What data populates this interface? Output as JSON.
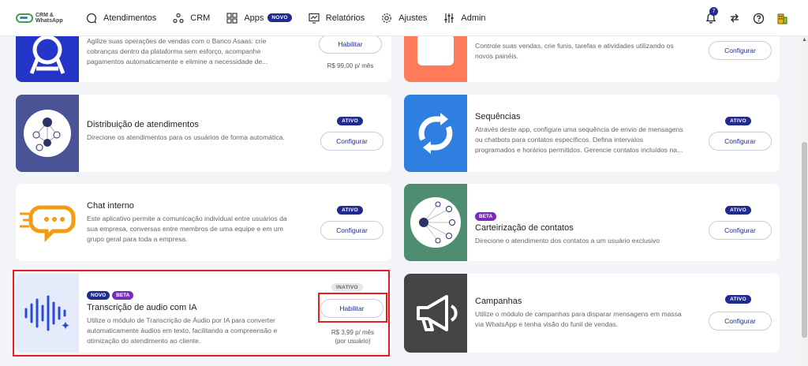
{
  "app": {
    "logo_text": "CRM & WhatsApp"
  },
  "nav": [
    {
      "label": "Atendimentos",
      "icon": "chat-icon"
    },
    {
      "label": "CRM",
      "icon": "crm-icon"
    },
    {
      "label": "Apps",
      "icon": "apps-grid-icon",
      "badge": "NOVO"
    },
    {
      "label": "Relatórios",
      "icon": "reports-icon"
    },
    {
      "label": "Ajustes",
      "icon": "gear-icon"
    },
    {
      "label": "Admin",
      "icon": "sliders-icon"
    }
  ],
  "topright": {
    "notifications": "7"
  },
  "cards": {
    "asaas": {
      "desc": "Agilize suas operações de vendas com o Banco Asaas: crie cobranças dentro da plataforma sem esforço, acompanhe pagamentos automaticamente e elimine a necessidade de...",
      "button": "Habilitar",
      "price": "R$ 99,00 p/ mês"
    },
    "funis": {
      "desc": "Controle suas vendas, crie funis, tarefas e atividades utilizando os novos painéis.",
      "button": "Configurar"
    },
    "distribuicao": {
      "title": "Distribuição de atendimentos",
      "desc": "Direcione os atendimentos para os usuários de forma automática.",
      "status": "ATIVO",
      "button": "Configurar"
    },
    "sequencias": {
      "title": "Sequências",
      "desc": "Através deste app, configure uma sequência de envio de mensagens ou chatbots para contatos específicos. Defina intervalos programados e horários permitidos. Gerencie contatos incluídos na...",
      "status": "ATIVO",
      "button": "Configurar"
    },
    "chat": {
      "title": "Chat interno",
      "desc": "Este aplicativo permite a comunicação individual entre usuários da sua empresa, conversas entre membros de uma equipe e em um grupo geral para toda a empresa.",
      "status": "ATIVO",
      "button": "Configurar"
    },
    "carteirizacao": {
      "tag": "BETA",
      "title": "Carteirização de contatos",
      "desc": "Direcione o atendimento dos contatos a um usuário exclusivo",
      "status": "ATIVO",
      "button": "Configurar"
    },
    "transcricao": {
      "tag_novo": "NOVO",
      "tag_beta": "BETA",
      "title": "Transcrição de audio com IA",
      "desc": "Utilize o módulo de Transcrição de Áudio por IA para converter automaticamente áudios em texto, facilitando a compreensão e otimização do atendimento ao cliente.",
      "status": "INATIVO",
      "button": "Habilitar",
      "price": "R$ 3,99 p/ mês",
      "price_note": "(por usuário)"
    },
    "campanhas": {
      "title": "Campanhas",
      "desc": "Utilize o módulo de campanhas para disparar mensagens em massa via WhatsApp e tenha visão do funil de vendas.",
      "status": "ATIVO",
      "button": "Configurar"
    }
  },
  "colors": {
    "accent": "#1f2b8f",
    "beta": "#7a2bb8",
    "highlight": "#e31e24",
    "asaas_thumb": "#2436c9",
    "funis_thumb": "#ff7a59",
    "distribuicao_thumb": "#4a5396",
    "sequencias_thumb": "#2f7fe0",
    "carteirizacao_thumb": "#4f8d73",
    "transcricao_thumb": "#e6ebfb",
    "campanhas_thumb": "#444444"
  }
}
